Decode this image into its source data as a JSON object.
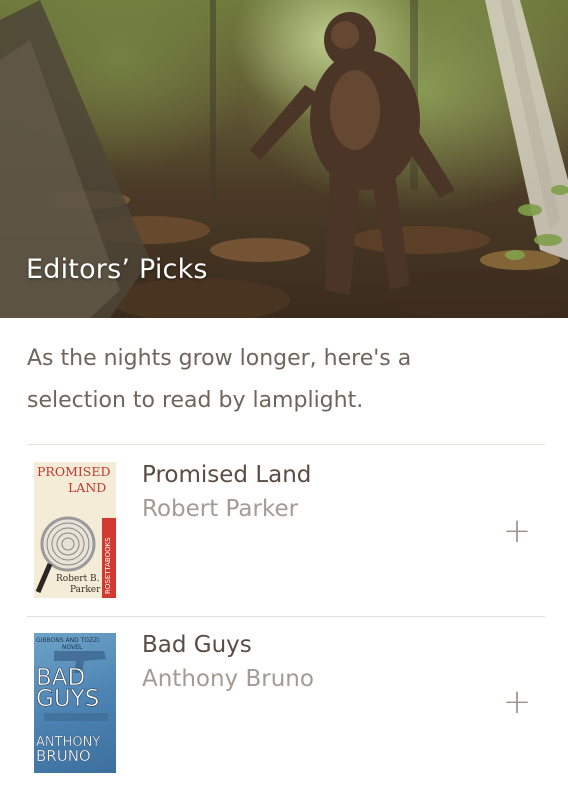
{
  "hero": {
    "title": "Editors’ Picks",
    "image": "forest-figurine-photo"
  },
  "intro": {
    "text": "As the nights grow longer, here's a selection to read by lamplight."
  },
  "books": [
    {
      "title": "Promised Land",
      "author": "Robert Parker",
      "add_icon": "plus-icon",
      "add_label": "+",
      "cover": {
        "line1": "PROMISED",
        "line2": "LAND",
        "spine": "ROSETTABOOKS",
        "author1": "Robert B.",
        "author2": "Parker",
        "accent": "#c8352e"
      }
    },
    {
      "title": "Bad Guys",
      "author": "Anthony Bruno",
      "add_icon": "plus-icon",
      "add_label": "+",
      "cover": {
        "series1": "GIBBONS AND TOZZI",
        "series2": "NOVEL",
        "line1": "BAD",
        "line2": "GUYS",
        "author1": "ANTHONY",
        "author2": "BRUNO",
        "accent": "#4d84b3"
      }
    }
  ],
  "colors": {
    "title_text": "#5a4b43",
    "author_text": "#a39b94",
    "body_text": "#6f655c",
    "divider": "#e4e0dc"
  }
}
